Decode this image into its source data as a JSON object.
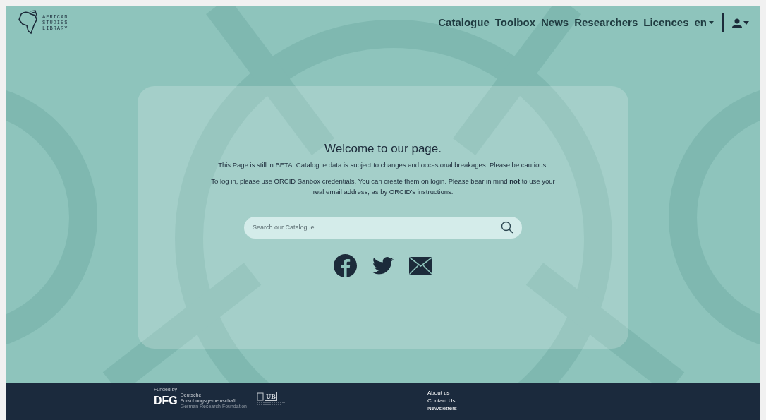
{
  "logo": {
    "lines": [
      "AFRICAN",
      "STUDIES",
      "LIBRARY"
    ]
  },
  "nav": {
    "items": [
      {
        "label": "Catalogue"
      },
      {
        "label": "Toolbox"
      },
      {
        "label": "News"
      },
      {
        "label": "Researchers"
      },
      {
        "label": "Licences"
      }
    ],
    "language": "en"
  },
  "welcome": {
    "title": "Welcome to our page.",
    "paragraphs": [
      "This Page is still in BETA. Catalogue data is subject to changes and occasional breakages. Please be cautious.",
      "To log in, please use ORCID Sanbox credentials. You can create them on login. Please bear in mind **not** to use your real email address, as by ORCID's instructions."
    ]
  },
  "search": {
    "placeholder": "Search our Catalogue"
  },
  "footer": {
    "funded_by": "Funded by",
    "dfg": "DFG",
    "dfg_name": "Deutsche Forschungsgemeinschaft",
    "dfg_english": "German Research Foundation",
    "ub": "UB",
    "links": [
      "About us",
      "Contact Us",
      "Newsletters"
    ]
  }
}
